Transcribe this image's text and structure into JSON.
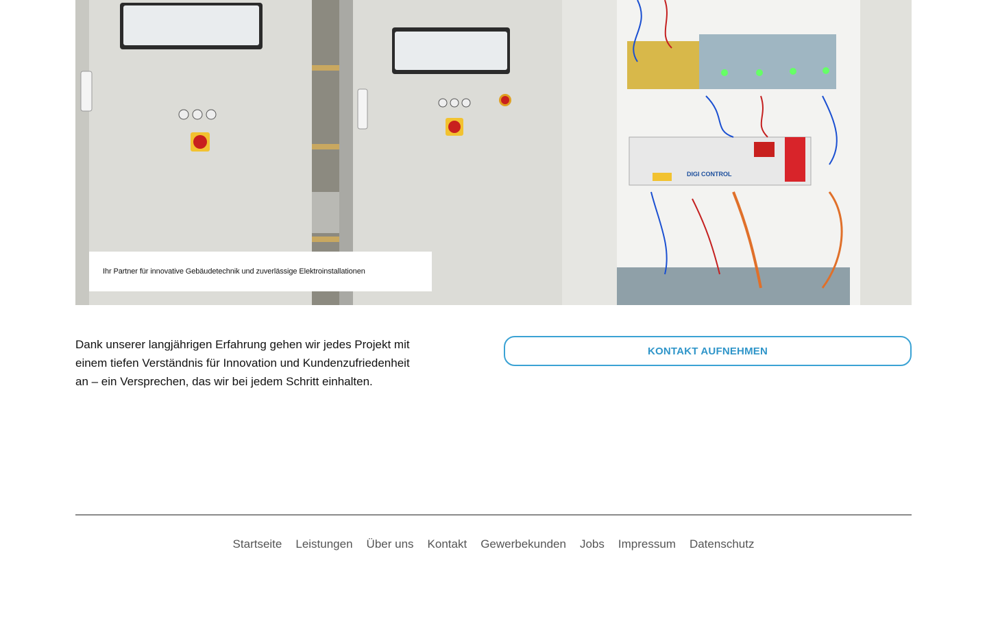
{
  "hero": {
    "image": "electrical-cabinets-photo",
    "caption": "Ihr Partner für innovative Gebäudetechnik und zuverlässige Elektroinstallationen",
    "device_labels": [
      "DIGI CONTROL"
    ]
  },
  "intro": {
    "text": "Dank unserer langjährigen Erfahrung gehen wir jedes Projekt mit einem tiefen Verständnis für Innovation und Kundenzufriedenheit an – ein Versprechen, das wir bei jedem Schritt einhalten."
  },
  "cta": {
    "label": "KONTAKT AUFNEHMEN",
    "color": "#3aa2d4"
  },
  "footer": {
    "links": [
      {
        "label": "Startseite"
      },
      {
        "label": "Leistungen"
      },
      {
        "label": "Über uns"
      },
      {
        "label": "Kontakt"
      },
      {
        "label": "Gewerbekunden"
      },
      {
        "label": "Jobs"
      },
      {
        "label": "Impressum"
      },
      {
        "label": "Datenschutz"
      }
    ]
  }
}
